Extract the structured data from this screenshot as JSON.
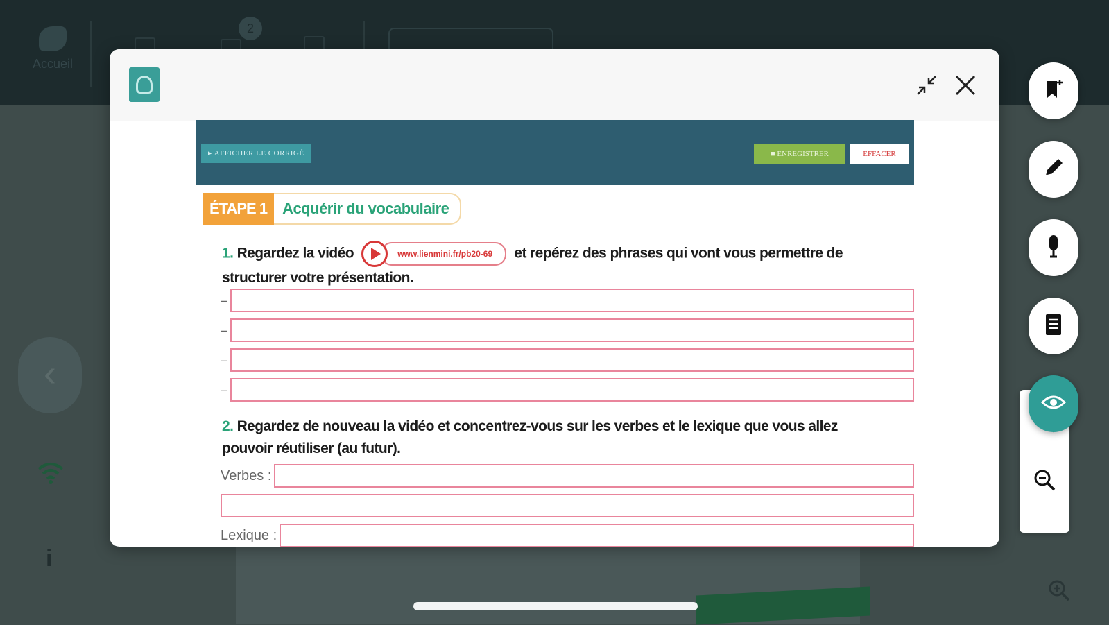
{
  "background": {
    "home_label": "Accueil",
    "badge_count": "2",
    "info_label": "i"
  },
  "modal": {
    "toolbar": {
      "show_correction": "AFFICHER LE CORRIGÉ",
      "save": "ENREGISTRER",
      "erase": "EFFACER"
    },
    "step": {
      "label": "ÉTAPE 1",
      "title": "Acquérir du vocabulaire"
    },
    "question1": {
      "number": "1.",
      "text_before": "Regardez la vidéo",
      "link": "www.lienmini.fr/pb20-69",
      "text_after": "et repérez des phrases qui vont vous permettre de structurer votre présentation.",
      "dash": "–"
    },
    "question2": {
      "number": "2.",
      "text": "Regardez de nouveau la vidéo et concentrez-vous sur les verbes et le lexique que vous allez pouvoir réutiliser (au futur).",
      "verbes_label": "Verbes :",
      "lexique_label": "Lexique :"
    }
  },
  "colors": {
    "accent_teal": "#2f9d96",
    "toolbar_blue": "#2e5d70",
    "step_orange": "#f2a23a",
    "title_green": "#2aa378",
    "answer_border": "#e9859c",
    "link_red": "#d83838"
  },
  "icons": {
    "logo": "app-logo-icon",
    "collapse": "collapse-icon",
    "close": "close-icon",
    "bookmark": "bookmark-icon",
    "pencil": "pencil-icon",
    "microphone": "microphone-icon",
    "notes": "notes-icon",
    "eye": "eye-icon",
    "zoom_in": "zoom-in-icon",
    "zoom_out": "zoom-out-icon"
  }
}
